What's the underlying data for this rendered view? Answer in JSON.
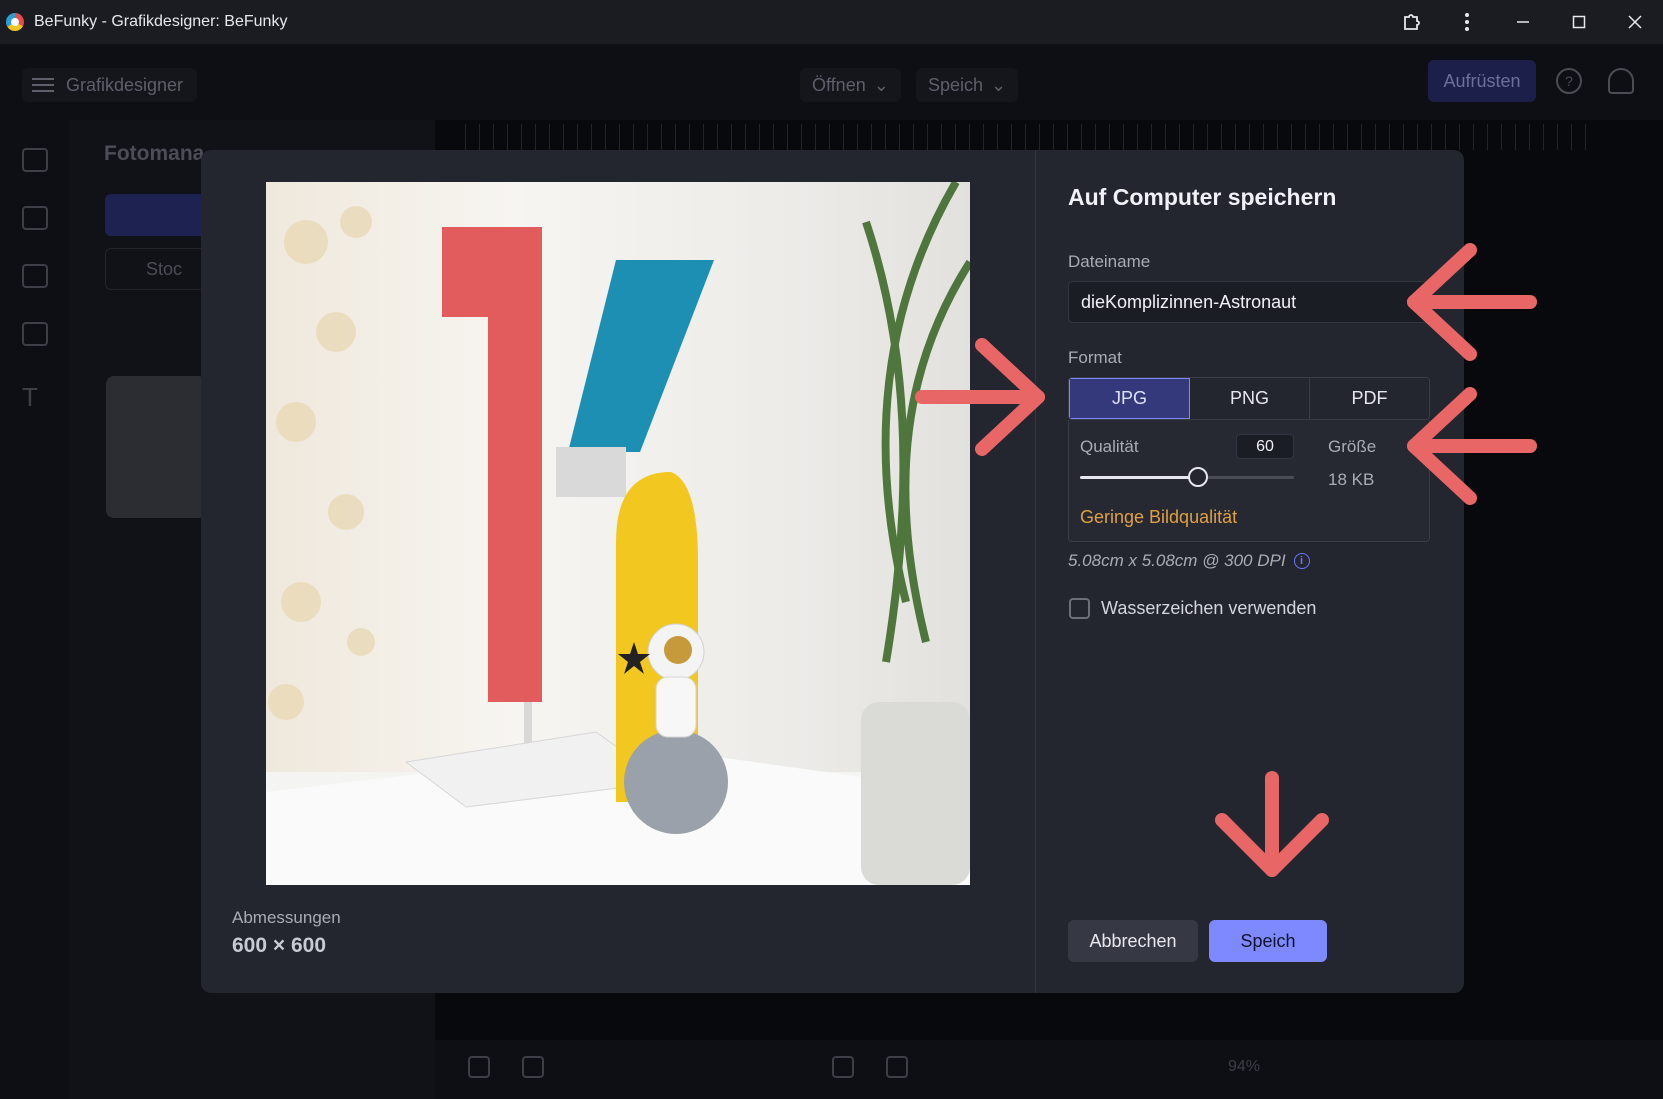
{
  "window": {
    "title": "BeFunky - Grafikdesigner: BeFunky",
    "extensions_icon": "puzzle-icon",
    "more_icon": "kebab-menu-icon",
    "minimize_icon": "minimize-icon",
    "maximize_icon": "maximize-icon",
    "close_icon": "close-icon"
  },
  "toolbar": {
    "menu_label": "Grafikdesigner",
    "open_label": "Öffnen",
    "save_label": "Speich",
    "upgrade_label": "Aufrüsten",
    "help_icon": "help-icon",
    "account_icon": "user-icon"
  },
  "side_panel": {
    "title": "Fotomana",
    "search_placeholder": "Stoc"
  },
  "canvas": {
    "zoom": "94%"
  },
  "preview": {
    "dimensions_label": "Abmessungen",
    "dimensions_value": "600 × 600"
  },
  "save_dialog": {
    "title": "Auf Computer speichern",
    "filename_label": "Dateiname",
    "filename_value": "dieKomplizinnen-Astronaut",
    "format_label": "Format",
    "formats": [
      {
        "label": "JPG",
        "active": true
      },
      {
        "label": "PNG",
        "active": false
      },
      {
        "label": "PDF",
        "active": false
      }
    ],
    "quality_label": "Qualität",
    "quality_value": "60",
    "quality_slider_fraction": 0.55,
    "size_label": "Größe",
    "size_value": "18 KB",
    "quality_warning": "Geringe Bildqualität",
    "dpi_info": "5.08cm x 5.08cm @ 300 DPI",
    "watermark_label": "Wasserzeichen verwenden",
    "watermark_checked": false,
    "cancel_label": "Abbrechen",
    "save_label": "Speich"
  },
  "colors": {
    "accent": "#7e89ff",
    "warning": "#e0a041",
    "annotation": "#e96666"
  }
}
